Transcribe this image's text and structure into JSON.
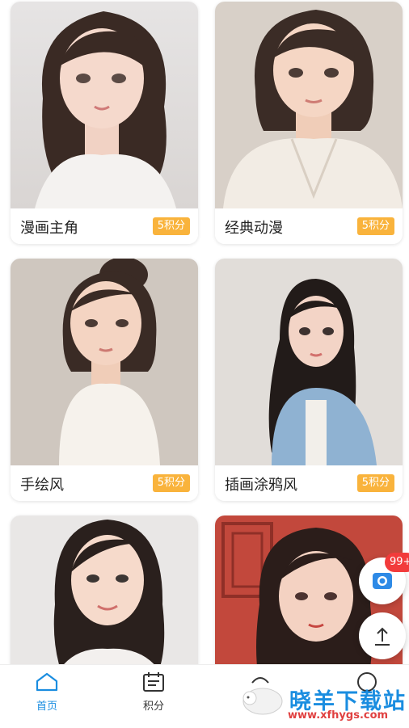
{
  "cards": [
    {
      "title": "漫画主角",
      "badge": "5积分"
    },
    {
      "title": "经典动漫",
      "badge": "5积分"
    },
    {
      "title": "手绘风",
      "badge": "5积分"
    },
    {
      "title": "插画涂鸦风",
      "badge": "5积分"
    },
    {
      "title": "",
      "badge": ""
    },
    {
      "title": "",
      "badge": ""
    }
  ],
  "tabbar": {
    "home_label": "首页",
    "points_label": "积分",
    "third_label": "",
    "fourth_label": "",
    "active_color": "#1a8de0"
  },
  "floating": {
    "badge_count": "99+"
  },
  "watermark": {
    "text": "晓羊下载站",
    "url": "www.xfhygs.com"
  }
}
